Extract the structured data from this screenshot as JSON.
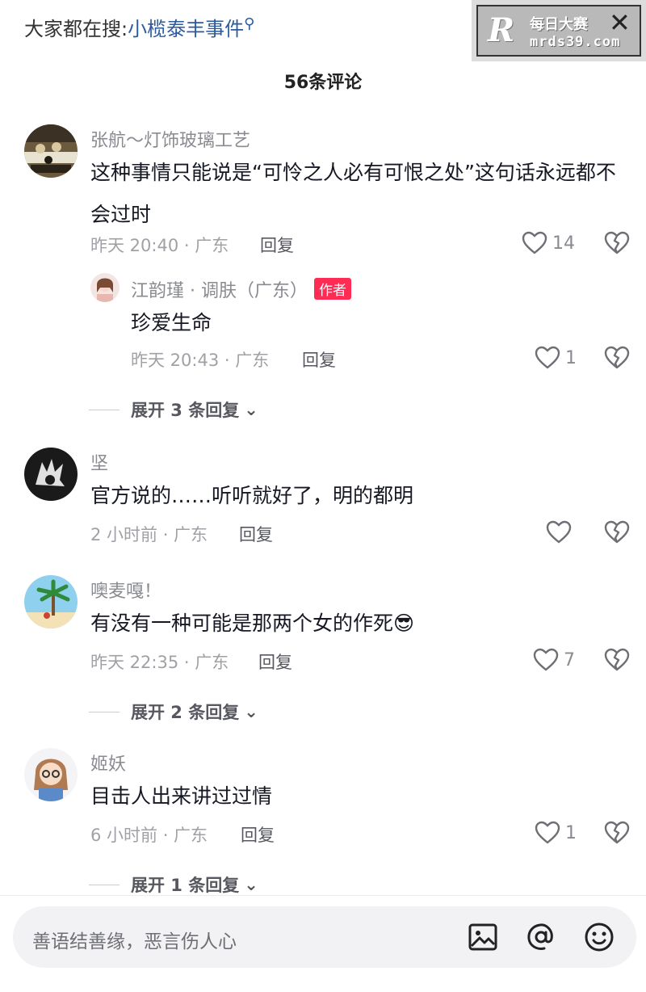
{
  "search": {
    "prefix": "大家都在搜:",
    "keyword": "小榄泰丰事件"
  },
  "watermark": {
    "logo": "R",
    "title": "每日大赛",
    "url": "mrds39.com"
  },
  "header": {
    "count_title": "56条评论"
  },
  "comments": [
    {
      "name": "张航～灯饰玻璃工艺",
      "text": "这种事情只能说是“可怜之人必有可恨之处”这句话永远都不会过时",
      "meta": "昨天 20:40 · 广东",
      "reply_label": "回复",
      "likes": "14",
      "reply": {
        "name": "江韵瑾 · 调肤（广东）",
        "badge": "作者",
        "text": "珍爱生命",
        "meta": "昨天 20:43 · 广东",
        "reply_label": "回复",
        "likes": "1"
      },
      "expand": "展开 3 条回复"
    },
    {
      "name": "坚",
      "text": "官方说的……听听就好了，明的都明",
      "meta": "2 小时前 · 广东",
      "reply_label": "回复",
      "likes": ""
    },
    {
      "name": "噢麦嘎！",
      "text": "有没有一种可能是那两个女的作死",
      "emoji": "😎",
      "meta": "昨天 22:35 · 广东",
      "reply_label": "回复",
      "likes": "7",
      "expand": "展开 2 条回复"
    },
    {
      "name": "姬妖",
      "text": "目击人出来讲过过情",
      "meta": "6 小时前 · 广东",
      "reply_label": "回复",
      "likes": "1",
      "expand": "展开 1 条回复"
    }
  ],
  "input": {
    "placeholder": "善语结善缘，恶言伤人心"
  },
  "icons": {
    "search": "magnifier-icon",
    "close": "close-icon",
    "like": "heart-icon",
    "dislike": "broken-heart-icon",
    "image": "image-icon",
    "mention": "at-icon",
    "emoji": "smiley-icon"
  },
  "colors": {
    "author_badge": "#fe2c55",
    "search_keyword": "#2d5a9c"
  }
}
